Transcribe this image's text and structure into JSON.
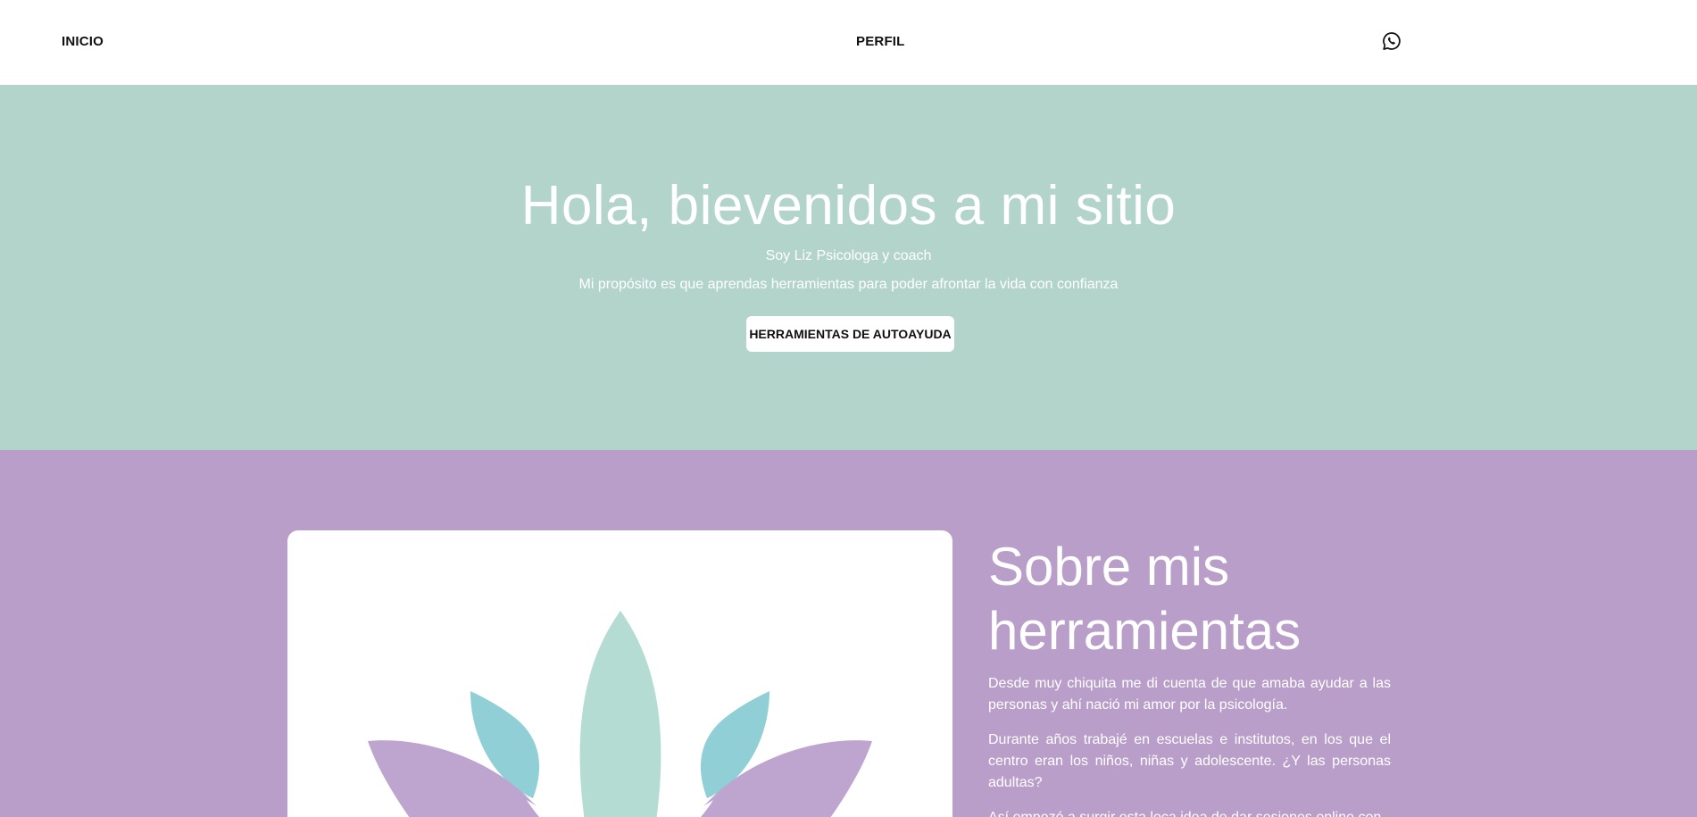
{
  "nav": {
    "inicio_label": "INICIO",
    "perfil_label": "PERFIL",
    "whatsapp_icon": "whatsapp-icon"
  },
  "hero": {
    "title": "Hola, bievenidos a mi sitio",
    "subtitle": "Soy Liz Psicologa y coach",
    "purpose": "Mi propósito es que aprendas herramientas para poder afrontar la vida con confianza",
    "button_label": "HERRAMIENTAS DE AUTOAYUDA"
  },
  "about": {
    "title_line1": "Sobre mis",
    "title_line2": "herramientas",
    "paragraphs": [
      "Desde muy chiquita me di cuenta de que amaba ayudar a las personas y ahí nació mi amor por la psicología.",
      "Durante años trabajé en escuelas e institutos, en los que el centro eran los niños, niñas y adolescente. ¿Y las personas adultas?",
      "Así empezó a surgir esta loca idea de dar sesiones online con"
    ]
  },
  "colors": {
    "hero_bg": "#b3d4cb",
    "about_bg": "#b89ec8",
    "lotus_teal_light": "#b5dcd3",
    "lotus_teal": "#90cfd6",
    "lotus_purple": "#bea5d0"
  }
}
